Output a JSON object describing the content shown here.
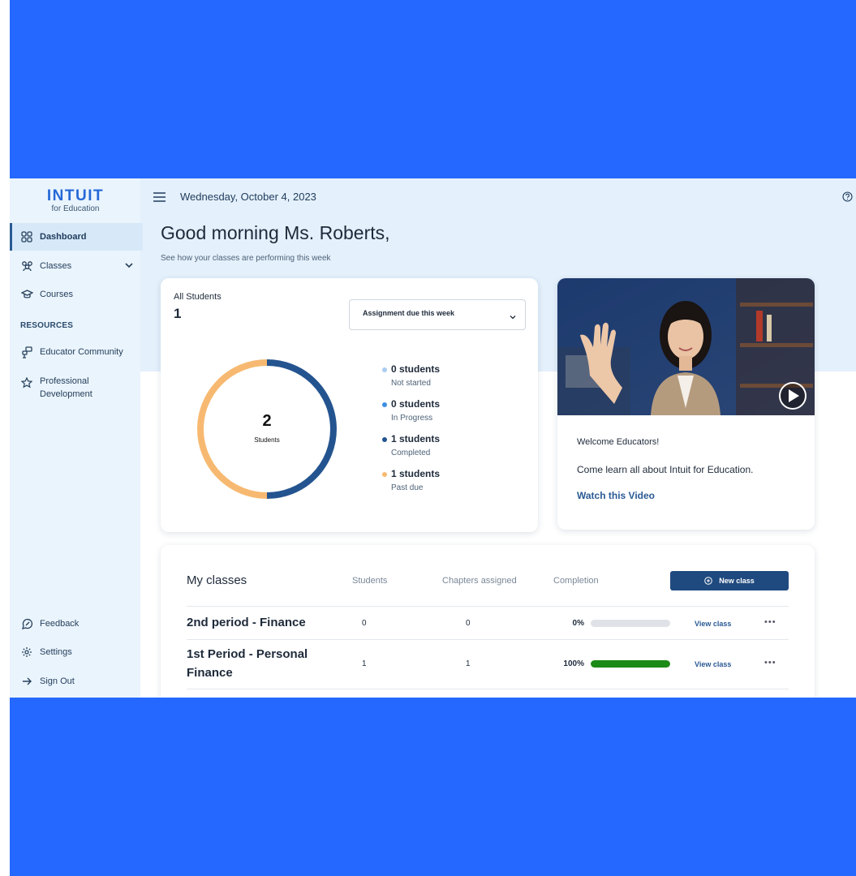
{
  "colors": {
    "frame": "#2568ff",
    "sidebar": "#eaf4fd",
    "accent": "#1f4a7f",
    "not_started": "#a9ccef",
    "in_progress": "#3d8ee0",
    "completed": "#24548f",
    "past_due": "#f7b971",
    "progress": "#1c8a16"
  },
  "brand": {
    "name": "INTUIT",
    "sub": "for Education"
  },
  "sidebar": {
    "items": [
      {
        "label": "Dashboard",
        "icon": "grid-icon",
        "active": true
      },
      {
        "label": "Classes",
        "icon": "group-icon",
        "expandable": true
      },
      {
        "label": "Courses",
        "icon": "graduation-cap-icon"
      }
    ],
    "resources_label": "RESOURCES",
    "resources": [
      {
        "label": "Educator Community",
        "icon": "community-icon"
      },
      {
        "label": "Professional Development",
        "icon": "star-icon"
      }
    ],
    "bottom": [
      {
        "label": "Feedback",
        "icon": "feedback-icon"
      },
      {
        "label": "Settings",
        "icon": "gear-icon"
      },
      {
        "label": "Sign Out",
        "icon": "arrow-right-icon"
      }
    ]
  },
  "header": {
    "date": "Wednesday, October 4, 2023"
  },
  "greeting": {
    "title": "Good morning Ms. Roberts,",
    "subtitle": "See how your classes are performing this week"
  },
  "students_card": {
    "label": "All Students",
    "count": "1",
    "filter": "Assignment due this week",
    "donut_total": "2",
    "donut_label": "Students",
    "legend": [
      {
        "count": "0 students",
        "status": "Not started",
        "value": 0
      },
      {
        "count": "0 students",
        "status": "In Progress",
        "value": 0
      },
      {
        "count": "1 students",
        "status": "Completed",
        "value": 1
      },
      {
        "count": "1 students",
        "status": "Past due",
        "value": 1
      }
    ]
  },
  "video_card": {
    "title": "Welcome Educators!",
    "description": "Come learn all about Intuit for Education.",
    "link": "Watch this Video"
  },
  "classes": {
    "title": "My classes",
    "columns": {
      "students": "Students",
      "chapters": "Chapters assigned",
      "completion": "Completion"
    },
    "new_class_label": "New class",
    "rows": [
      {
        "name": "2nd period - Finance",
        "students": "0",
        "chapters": "0",
        "completion": "0%",
        "completion_value": 0,
        "view": "View class",
        "more": "•••"
      },
      {
        "name": "1st Period - Personal Finance",
        "students": "1",
        "chapters": "1",
        "completion": "100%",
        "completion_value": 1,
        "view": "View class",
        "more": "•••"
      }
    ]
  }
}
